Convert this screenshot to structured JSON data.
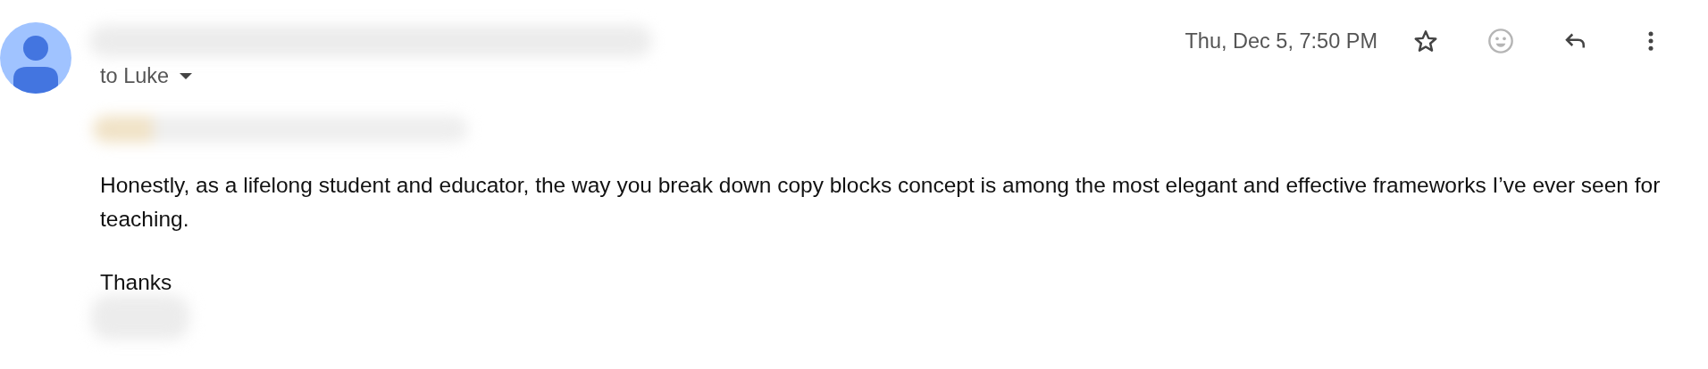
{
  "message": {
    "recipient": "to Luke",
    "date": "Thu, Dec 5, 7:50 PM",
    "body": "Honestly, as a lifelong student and educator, the way you break down copy blocks concept is among the most elegant and effective frameworks I’ve ever seen for teaching.",
    "closing": "Thanks"
  }
}
